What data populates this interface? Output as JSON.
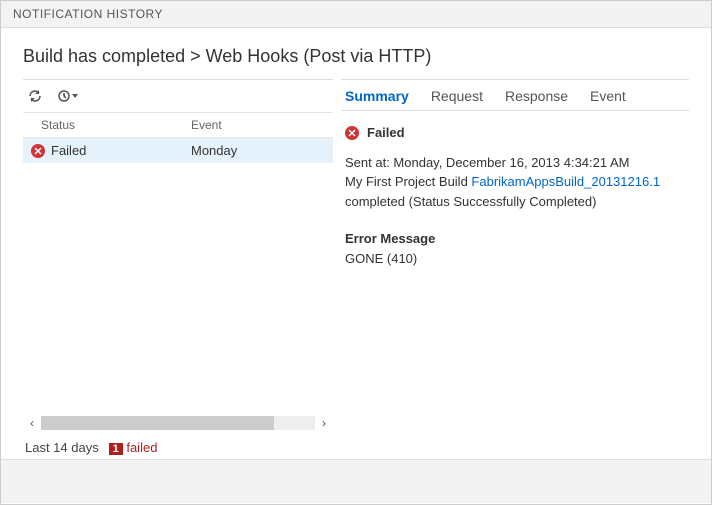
{
  "window": {
    "header": "NOTIFICATION HISTORY",
    "title": "Build has completed > Web Hooks (Post via HTTP)"
  },
  "grid": {
    "status_header": "Status",
    "event_header": "Event",
    "rows": [
      {
        "status": "Failed",
        "event": "Monday"
      }
    ]
  },
  "footer": {
    "range": "Last 14 days",
    "fail_count": "1",
    "fail_label": "failed"
  },
  "tabs": {
    "summary": "Summary",
    "request": "Request",
    "response": "Response",
    "event": "Event"
  },
  "detail": {
    "status": "Failed",
    "sent_prefix": "Sent at: ",
    "sent_time": "Monday, December 16, 2013 4:34:21 AM",
    "line2_prefix": "My First Project Build ",
    "line2_link": "FabrikamAppsBuild_20131216.1",
    "line2_suffix": " completed (Status Successfully Completed)",
    "error_heading": "Error Message",
    "error_body": "GONE (410)"
  }
}
